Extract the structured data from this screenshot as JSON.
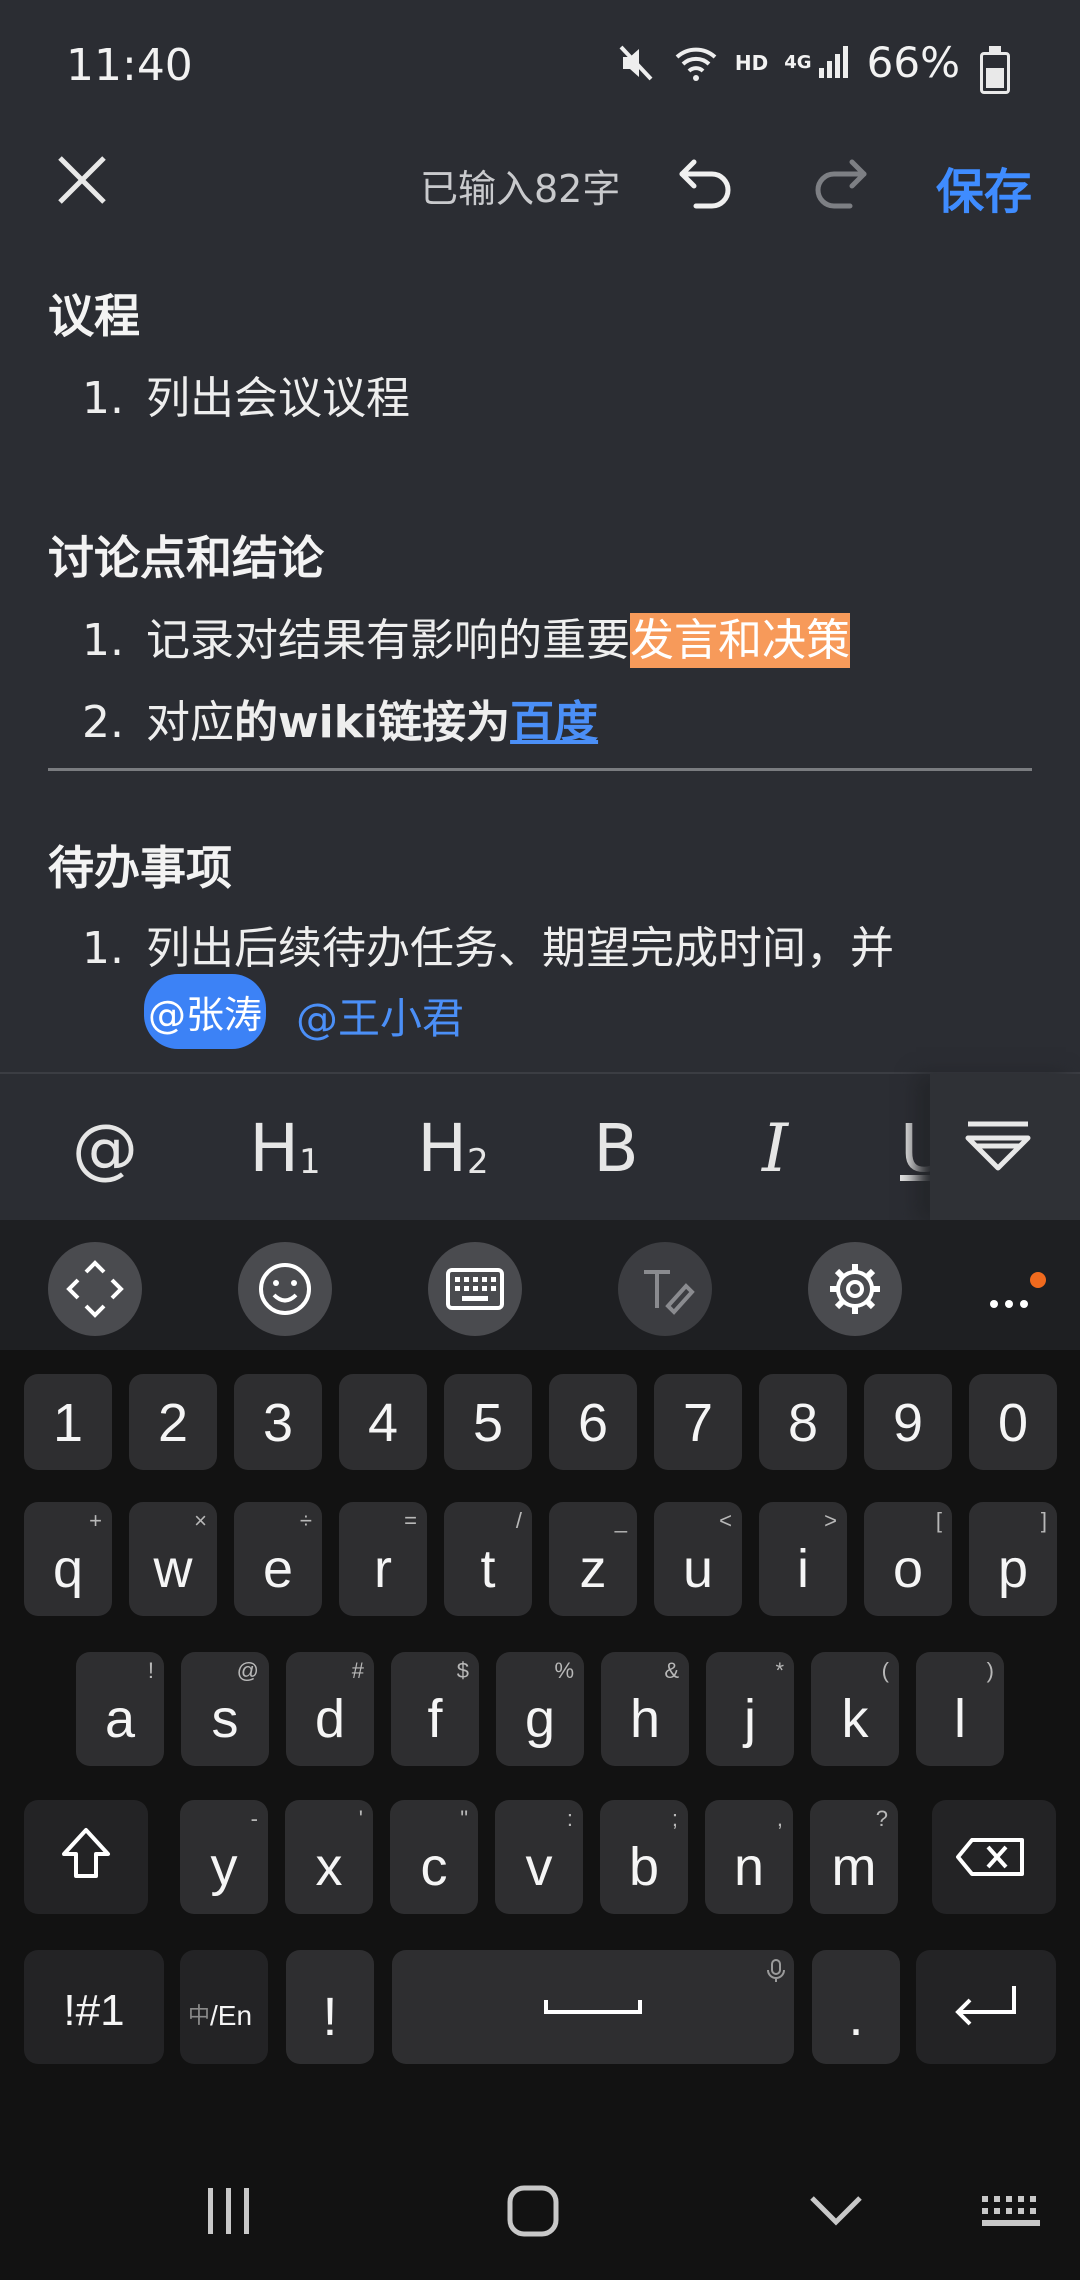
{
  "status": {
    "time": "11:40",
    "battery": "66%",
    "hd": "HD",
    "network": "4G"
  },
  "toolbar": {
    "counter": "已输入82字",
    "save": "保存"
  },
  "doc": {
    "h1": "议程",
    "agenda": [
      {
        "num": "1.",
        "text": "列出会议议程"
      }
    ],
    "h2": "讨论点和结论",
    "disc1": {
      "num": "1.",
      "text": "记录对结果有影响的重要",
      "highlight": "发言和决策"
    },
    "disc2": {
      "num": "2.",
      "pre": "对应",
      "bold": "的wiki链接为",
      "link": "百度"
    },
    "h3": "待办事项",
    "todo1": {
      "num": "1.",
      "text": "列出后续待办任务、期望完成时间，并"
    },
    "mention_chip": "@张涛",
    "mention": "@王小君"
  },
  "format_bar": {
    "items": [
      "@",
      "H",
      "1",
      "H",
      "2",
      "B",
      "I",
      "U"
    ]
  },
  "keyboard": {
    "numbers": [
      "1",
      "2",
      "3",
      "4",
      "5",
      "6",
      "7",
      "8",
      "9",
      "0"
    ],
    "row1": [
      {
        "k": "q",
        "s": "+"
      },
      {
        "k": "w",
        "s": "×"
      },
      {
        "k": "e",
        "s": "÷"
      },
      {
        "k": "r",
        "s": "="
      },
      {
        "k": "t",
        "s": "/"
      },
      {
        "k": "z",
        "s": "_"
      },
      {
        "k": "u",
        "s": "<"
      },
      {
        "k": "i",
        "s": ">"
      },
      {
        "k": "o",
        "s": "["
      },
      {
        "k": "p",
        "s": "]"
      }
    ],
    "row2": [
      {
        "k": "a",
        "s": "!"
      },
      {
        "k": "s",
        "s": "@"
      },
      {
        "k": "d",
        "s": "#"
      },
      {
        "k": "f",
        "s": "$"
      },
      {
        "k": "g",
        "s": "%"
      },
      {
        "k": "h",
        "s": "&"
      },
      {
        "k": "j",
        "s": "*"
      },
      {
        "k": "k",
        "s": "("
      },
      {
        "k": "l",
        "s": ")"
      }
    ],
    "row3": [
      {
        "k": "y",
        "s": "-"
      },
      {
        "k": "x",
        "s": "'"
      },
      {
        "k": "c",
        "s": "\""
      },
      {
        "k": "v",
        "s": ":"
      },
      {
        "k": "b",
        "s": ";"
      },
      {
        "k": "n",
        "s": ","
      },
      {
        "k": "m",
        "s": "?"
      }
    ],
    "sym": "!#1",
    "lang_zh": "中",
    "lang_en": "/En",
    "excl": "!",
    "period": "."
  },
  "colors": {
    "accent": "#3f8cff",
    "highlight": "#f79a5a",
    "background": "#2b2d33"
  }
}
